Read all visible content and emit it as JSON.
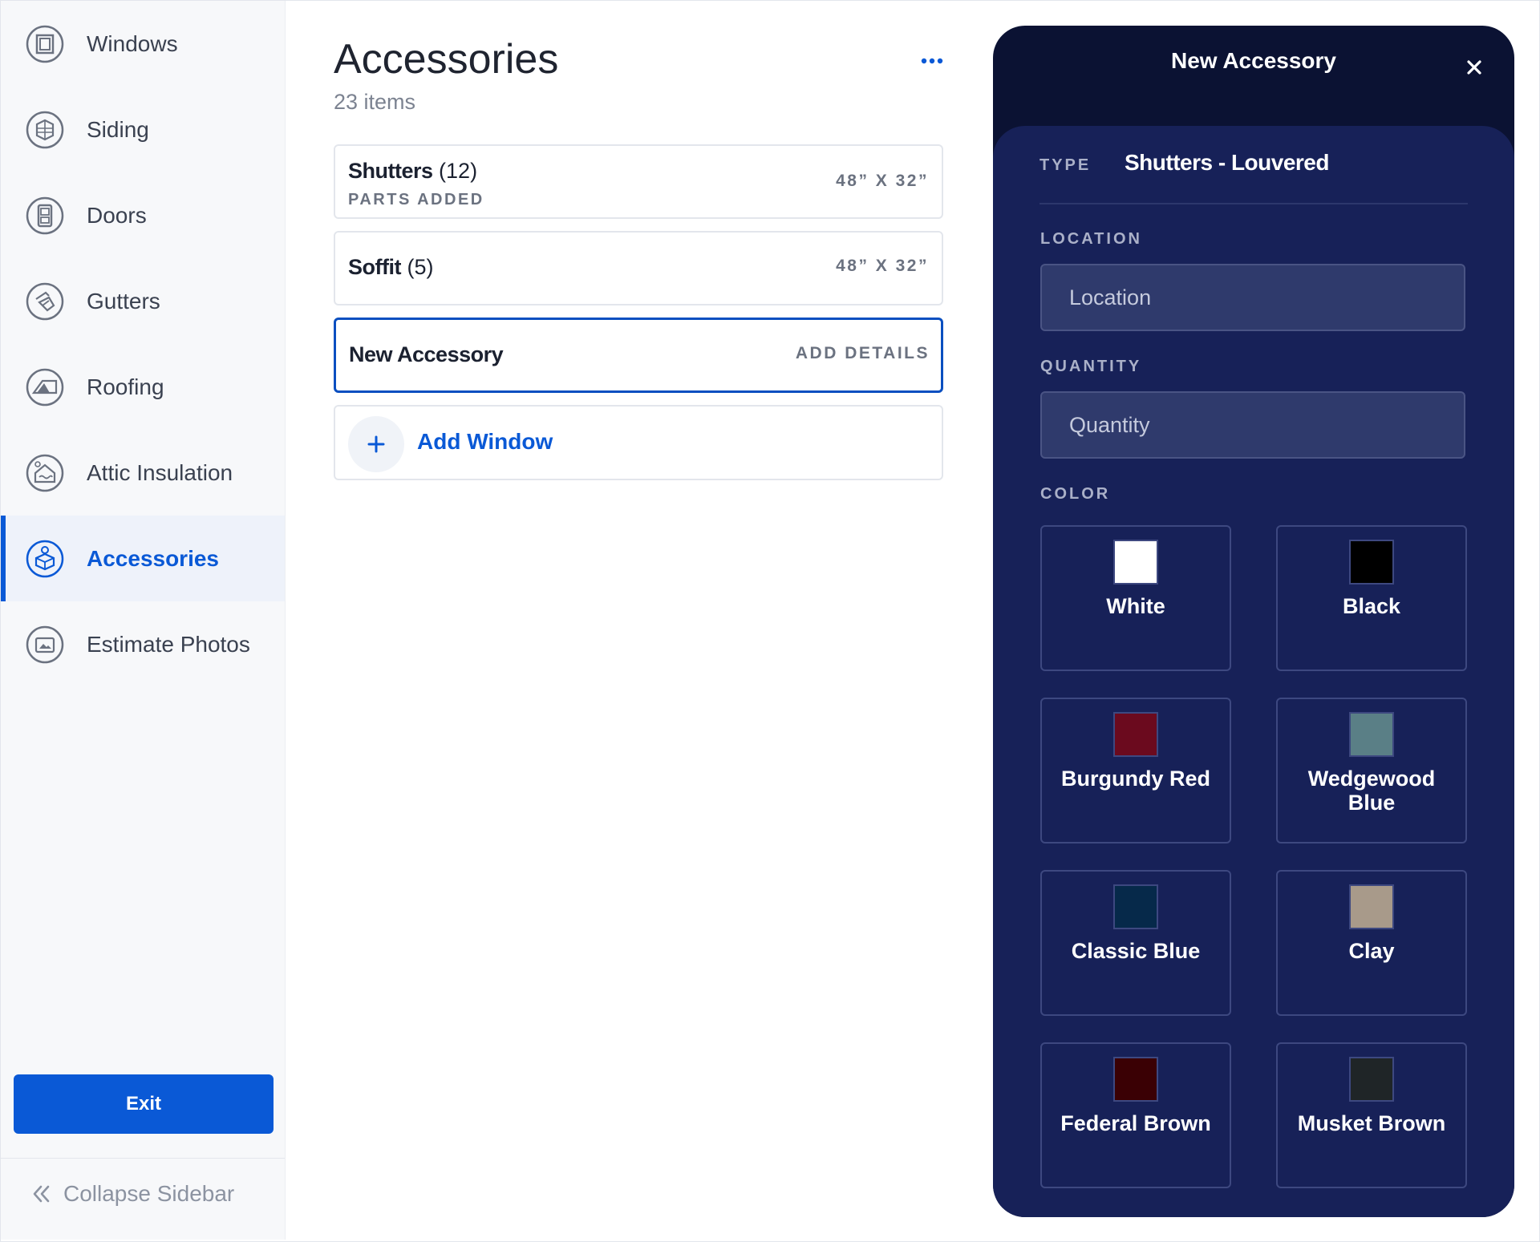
{
  "sidebar": {
    "items": [
      {
        "label": "Windows",
        "icon": "window-icon"
      },
      {
        "label": "Siding",
        "icon": "siding-icon"
      },
      {
        "label": "Doors",
        "icon": "door-icon"
      },
      {
        "label": "Gutters",
        "icon": "gutter-icon"
      },
      {
        "label": "Roofing",
        "icon": "roofing-icon"
      },
      {
        "label": "Attic Insulation",
        "icon": "attic-insulation-icon"
      },
      {
        "label": "Accessories",
        "icon": "accessories-icon",
        "active": true
      },
      {
        "label": "Estimate Photos",
        "icon": "photos-icon"
      }
    ],
    "exit_label": "Exit",
    "collapse_label": "Collapse Sidebar"
  },
  "main": {
    "title": "Accessories",
    "count": "23 items",
    "cards": [
      {
        "name": "Shutters",
        "qty": "(12)",
        "sub": "PARTS ADDED",
        "dims": "48” X 32”"
      },
      {
        "name": "Soffit",
        "qty": "(5)",
        "dims": "48” X 32”"
      },
      {
        "name": "New Accessory",
        "action": "ADD DETAILS"
      }
    ],
    "add_label": "Add Window"
  },
  "panel": {
    "title": "New Accessory",
    "type_label": "TYPE",
    "type_value": "Shutters - Louvered",
    "location_label": "LOCATION",
    "location_placeholder": "Location",
    "quantity_label": "QUANTITY",
    "quantity_placeholder": "Quantity",
    "color_label": "COLOR",
    "colors": [
      {
        "name": "White",
        "hex": "#ffffff"
      },
      {
        "name": "Black",
        "hex": "#000000"
      },
      {
        "name": "Burgundy Red",
        "hex": "#6b0a1e"
      },
      {
        "name": "Wedgewood Blue",
        "hex": "#5a7f86"
      },
      {
        "name": "Classic Blue",
        "hex": "#06294a"
      },
      {
        "name": "Clay",
        "hex": "#a89a8a"
      },
      {
        "name": "Federal Brown",
        "hex": "#3a0004"
      },
      {
        "name": "Musket Brown",
        "hex": "#1f2527"
      }
    ]
  },
  "accent_color": "#0a59d6"
}
